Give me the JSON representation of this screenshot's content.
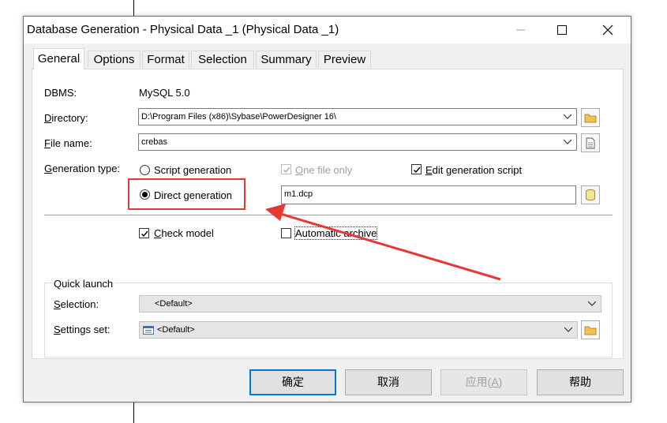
{
  "window": {
    "title": "Database Generation - Physical Data _1 (Physical Data _1)",
    "minimize_glyph": "—",
    "maximize_glyph": "☐",
    "close_glyph": "✕"
  },
  "tabs": [
    "General",
    "Options",
    "Format",
    "Selection",
    "Summary",
    "Preview"
  ],
  "general": {
    "dbms_label": "DBMS:",
    "dbms_value": "MySQL 5.0",
    "directory_label_key": "D",
    "directory_label_rest": "irectory:",
    "directory_value": "D:\\Program Files (x86)\\Sybase\\PowerDesigner 16\\",
    "filename_label_key": "F",
    "filename_label_rest": "ile name:",
    "filename_value": "crebas",
    "gen_type_label_key": "G",
    "gen_type_label_rest": "eneration type:",
    "script_generation": "Script generation",
    "direct_generation": "Direct generation",
    "one_file_only_key": "O",
    "one_file_only_rest": "ne file only",
    "edit_script_key": "E",
    "edit_script_rest": "dit generation script",
    "datasource_value": "m1.dcp",
    "check_model_key": "C",
    "check_model_rest": "heck model",
    "auto_archive": "Automatic archive"
  },
  "quick_launch": {
    "group_label": "Quick launch",
    "selection_label_key": "S",
    "selection_label_rest": "election:",
    "selection_value": "<Default>",
    "settings_label_key": "S",
    "settings_label_rest": "ettings set:",
    "settings_value": "<Default>"
  },
  "buttons": {
    "ok": "确定",
    "cancel": "取消",
    "apply_prefix": "应用(",
    "apply_key": "A",
    "apply_suffix": ")",
    "help": "帮助"
  },
  "state": {
    "generation_type": "direct",
    "one_file_only": true,
    "edit_generation_script": true,
    "check_model": true,
    "automatic_archive": false
  },
  "colors": {
    "annotation_red": "#e53935",
    "default_button_border": "#0078d7"
  }
}
